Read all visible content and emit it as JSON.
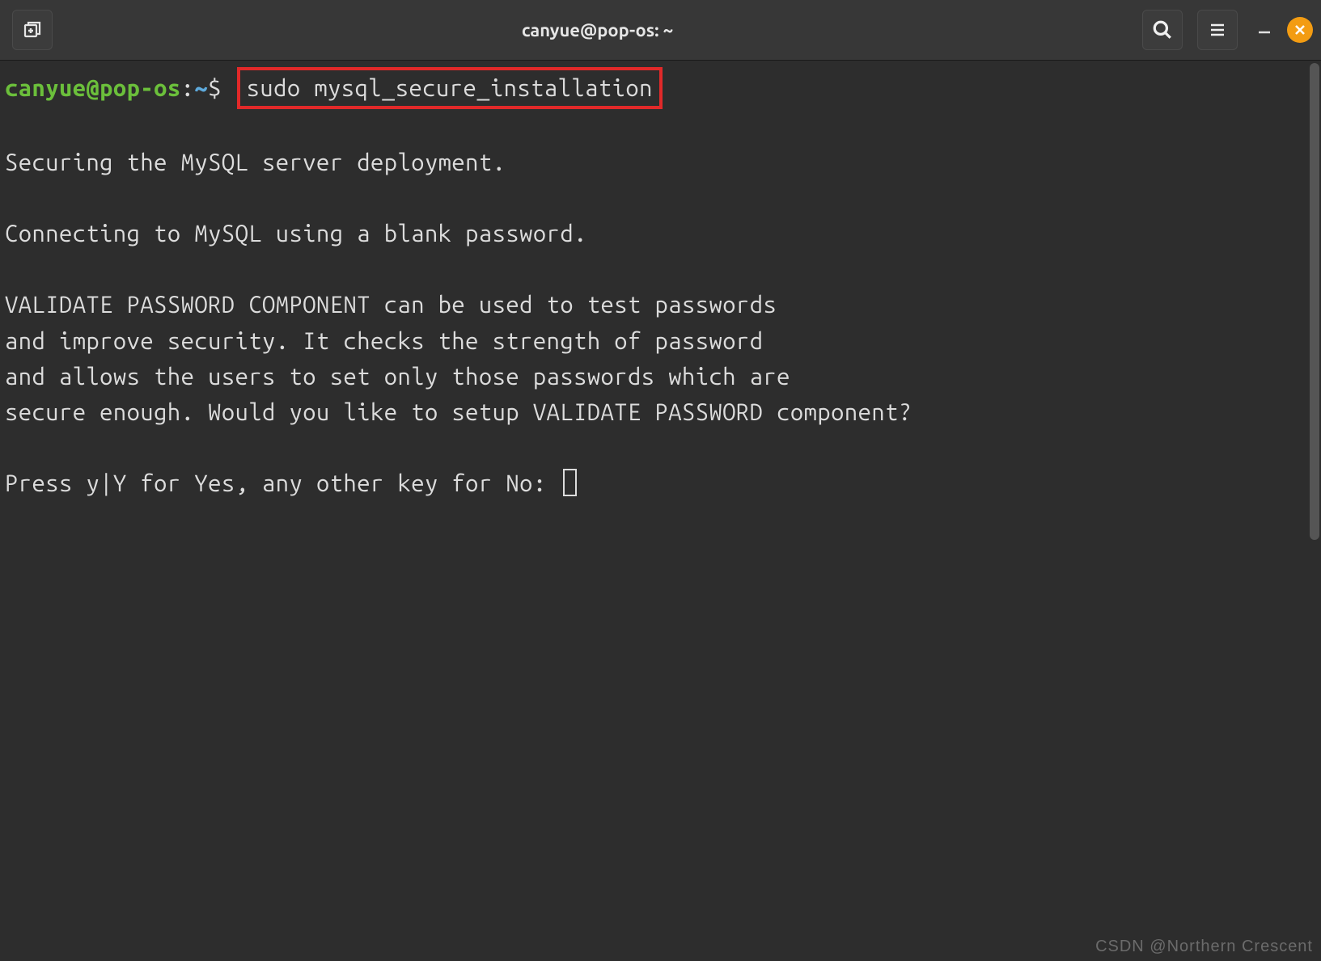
{
  "titlebar": {
    "title": "canyue@pop-os: ~"
  },
  "prompt": {
    "user_host": "canyue@pop-os",
    "colon": ":",
    "path": "~",
    "dollar": "$",
    "command": "sudo mysql_secure_installation"
  },
  "output": {
    "line1": "Securing the MySQL server deployment.",
    "line2": "Connecting to MySQL using a blank password.",
    "line3": "VALIDATE PASSWORD COMPONENT can be used to test passwords",
    "line4": "and improve security. It checks the strength of password",
    "line5": "and allows the users to set only those passwords which are",
    "line6": "secure enough. Would you like to setup VALIDATE PASSWORD component?",
    "line7": "Press y|Y for Yes, any other key for No: "
  },
  "watermark": "CSDN @Northern   Crescent"
}
